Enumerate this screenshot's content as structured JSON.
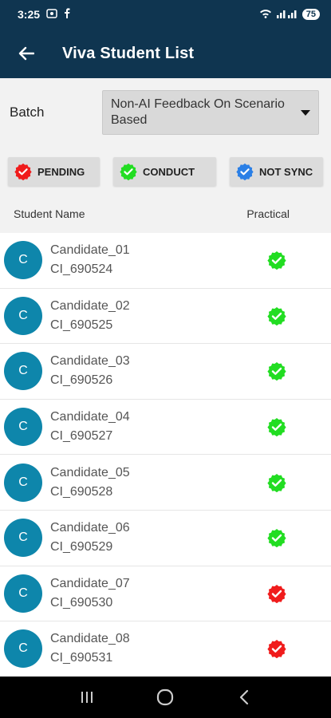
{
  "status_bar": {
    "time": "3:25",
    "battery": "75"
  },
  "app_bar": {
    "title": "Viva Student List"
  },
  "batch": {
    "label": "Batch",
    "selected": "Non-AI Feedback On Scenario Based"
  },
  "legend": [
    {
      "label": "PENDING",
      "color": "#f01c1c"
    },
    {
      "label": "CONDUCT",
      "color": "#22dd22"
    },
    {
      "label": "NOT SYNC",
      "color": "#2a7fe6"
    }
  ],
  "list_header": {
    "name_col": "Student Name",
    "status_col": "Practical"
  },
  "students": [
    {
      "initial": "C",
      "name": "Candidate_01",
      "id": "CI_690524",
      "status": "conduct"
    },
    {
      "initial": "C",
      "name": "Candidate_02",
      "id": "CI_690525",
      "status": "conduct"
    },
    {
      "initial": "C",
      "name": "Candidate_03",
      "id": "CI_690526",
      "status": "conduct"
    },
    {
      "initial": "C",
      "name": "Candidate_04",
      "id": "CI_690527",
      "status": "conduct"
    },
    {
      "initial": "C",
      "name": "Candidate_05",
      "id": "CI_690528",
      "status": "conduct"
    },
    {
      "initial": "C",
      "name": "Candidate_06",
      "id": "CI_690529",
      "status": "conduct"
    },
    {
      "initial": "C",
      "name": "Candidate_07",
      "id": "CI_690530",
      "status": "pending"
    },
    {
      "initial": "C",
      "name": "Candidate_08",
      "id": "CI_690531",
      "status": "pending"
    }
  ],
  "colors": {
    "primary": "#0f3550",
    "avatar": "#0e86ab",
    "pending": "#f01c1c",
    "conduct": "#22dd22",
    "not_sync": "#2a7fe6"
  }
}
